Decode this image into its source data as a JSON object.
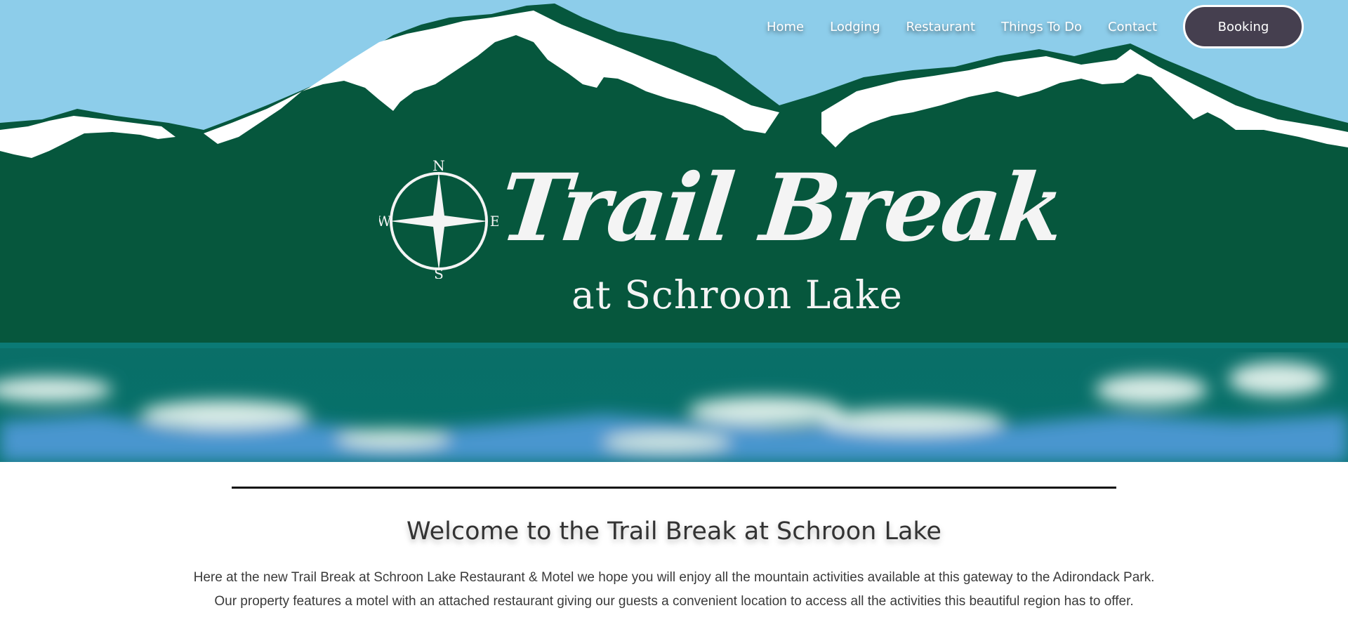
{
  "nav": {
    "links": [
      "Home",
      "Lodging",
      "Restaurant",
      "Things To Do",
      "Contact"
    ],
    "booking_label": "Booking"
  },
  "logo": {
    "title": "Trail Break",
    "subtitle": "at Schroon Lake",
    "compass": {
      "n": "N",
      "e": "E",
      "s": "S",
      "w": "W"
    }
  },
  "main": {
    "heading": "Welcome to the Trail Break at Schroon Lake",
    "body": "Here at the new Trail Break at Schroon Lake Restaurant & Motel we hope you will enjoy all the mountain activities available at this gateway to the Adirondack Park. Our property features a motel with an attached restaurant giving our guests a convenient location to access all the activities this beautiful region has to offer."
  },
  "colors": {
    "sky": "#8dcdea",
    "mountain": "#06573d",
    "snow": "#ffffff",
    "lake": "#04706a",
    "booking_bg": "#453f4f"
  }
}
